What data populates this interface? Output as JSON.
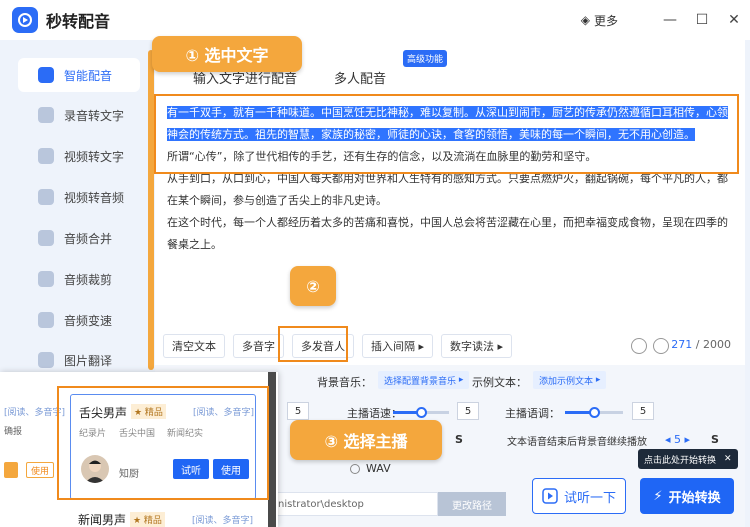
{
  "app": {
    "title": "秒转配音",
    "more": "更多"
  },
  "sidebar": {
    "items": [
      {
        "label": "智能配音",
        "active": true,
        "icon": "smart-dubbing-icon"
      },
      {
        "label": "录音转文字",
        "icon": "recording-to-text-icon"
      },
      {
        "label": "视频转文字",
        "icon": "video-to-text-icon"
      },
      {
        "label": "视频转音频",
        "icon": "video-to-audio-icon"
      },
      {
        "label": "音频合并",
        "icon": "audio-merge-icon"
      },
      {
        "label": "音频裁剪",
        "icon": "audio-trim-icon"
      },
      {
        "label": "音频变速",
        "icon": "audio-speed-icon"
      },
      {
        "label": "图片翻译",
        "icon": "image-translate-icon"
      }
    ]
  },
  "tabs": {
    "single": "输入文字进行配音",
    "multi": "多人配音",
    "badge": "高级功能"
  },
  "editor": {
    "selected_text": "有一千双手，就有一千种味道。中国烹饪无比神秘，难以复制。从深山到闹市，厨艺的传承仍然遵循口耳相传，心领神会的传统方式。祖先的智慧，家族的秘密，师徒的心诀，食客的领悟，美味的每一个瞬间，无不用心创造。",
    "line2": "所谓“心传”，除了世代相传的手艺，还有生存的信念，以及流淌在血脉里的勤劳和坚守。",
    "line3": "从手到口，从口到心，中国人每天都用对世界和人生特有的感知方式。只要点燃炉火，翻起锅碗，每个平凡的人，都在某个瞬间，参与创造了舌尖上的非凡史诗。",
    "line4": "在这个时代，每一个人都经历着太多的苦痛和喜悦，中国人总会将苦涩藏在心里，而把幸福变成食物，呈现在四季的餐桌之上。"
  },
  "toolbar": {
    "clear": "清空文本",
    "polyphone": "多音字",
    "multi_voice": "多发音人",
    "insert_pause": "插入间隔",
    "digit_read": "数字读法",
    "count_current": "271",
    "count_max": "/ 2000"
  },
  "settings": {
    "bg_music_label": "背景音乐：",
    "bg_music_btn": "选择配置背景音乐",
    "sample_label": "示例文本：",
    "sample_btn": "添加示例文本",
    "speed_label": "主播语速：",
    "speed_value": "5",
    "pitch_label": "主播语调：",
    "pitch_value": "5",
    "left_value": "5",
    "left_value2": "5",
    "bg_continue": "文本语音结束后背景音继续播放",
    "bg_continue_value": "5",
    "bg_continue_unit": "S",
    "s_unit": "S",
    "wav_label": "WAV",
    "path_value": "nistrator\\desktop",
    "path_btn": "更改路径",
    "speed_level": 0.5,
    "pitch_level": 0.5
  },
  "actions": {
    "trial": "试听一下",
    "start": "开始转换",
    "tooltip": "点击此处开始转换"
  },
  "voice_panel": {
    "top_left_tag": "[阅读、多音字]",
    "top_left_tag2": "确报",
    "top_left_use": "使用",
    "card": {
      "name": "舌尖男声",
      "tier": "★ 精品",
      "tags": "[阅读、多音字]",
      "cat1": "纪录片",
      "cat2": "舌尖中国",
      "cat3": "新闻纪实",
      "speaker": "知厨",
      "listen": "试听",
      "use": "使用"
    },
    "next": {
      "name": "新闻男声",
      "tier": "★ 精品",
      "tags": "[阅读、多音字]"
    }
  },
  "annotations": {
    "step1": "① 选中文字",
    "step2": "②",
    "step3": "③ 选择主播"
  },
  "colors": {
    "accent": "#2b6cf6",
    "highlight": "#f08a1c",
    "callout": "#f4a73d"
  }
}
